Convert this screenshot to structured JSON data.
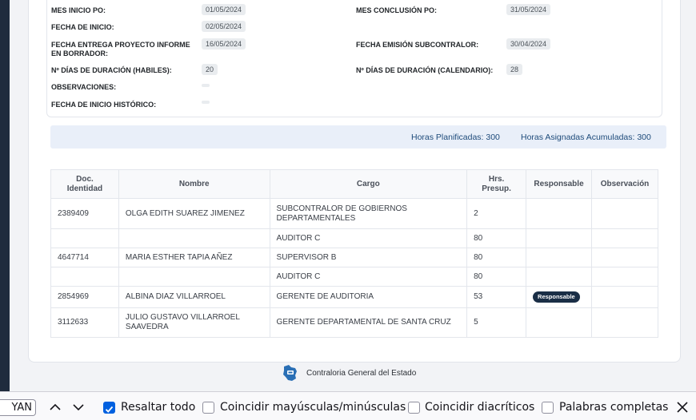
{
  "details": {
    "mes_inicio_label": "MES INICIO PO:",
    "mes_inicio_value": "01/05/2024",
    "mes_conclusion_label": "MES CONCLUSIÓN PO:",
    "mes_conclusion_value": "31/05/2024",
    "fecha_inicio_label": "FECHA DE INICIO:",
    "fecha_inicio_value": "02/05/2024",
    "fecha_entrega_label_1": "FECHA ENTREGA PROYECTO INFORME",
    "fecha_entrega_label_2": "EN BORRADOR:",
    "fecha_entrega_value": "16/05/2024",
    "fecha_emision_label": "FECHA EMISIÓN SUBCONTRALOR:",
    "fecha_emision_value": "30/04/2024",
    "dias_habiles_label": "Nº DÍAS DE DURACIÓN (HABILES):",
    "dias_habiles_value": "20",
    "dias_calendario_label": "Nº DÍAS DE DURACIÓN (CALENDARIO):",
    "dias_calendario_value": "28",
    "observaciones_label": "OBSERVACIONES:",
    "observaciones_value": "",
    "fecha_historico_label": "FECHA DE INICIO HISTÓRICO:",
    "fecha_historico_value": ""
  },
  "hours": {
    "planificadas": "Horas Planificadas: 300",
    "asignadas": "Horas Asignadas Acumuladas: 300"
  },
  "table": {
    "headers": {
      "doc_1": "Doc.",
      "doc_2": "Identidad",
      "nombre": "Nombre",
      "cargo": "Cargo",
      "hrs_1": "Hrs.",
      "hrs_2": "Presup.",
      "responsable": "Responsable",
      "observacion": "Observación"
    },
    "rows": [
      {
        "doc": "2389409",
        "nombre": "OLGA EDITH SUAREZ JIMENEZ",
        "cargo": "SUBCONTRALOR DE GOBIERNOS DEPARTAMENTALES",
        "hrs": "2",
        "responsable": "",
        "observacion": ""
      },
      {
        "doc": "",
        "nombre": "",
        "cargo": "AUDITOR C",
        "hrs": "80",
        "responsable": "",
        "observacion": ""
      },
      {
        "doc": "4647714",
        "nombre": "MARIA ESTHER TAPIA AÑEZ",
        "cargo": "SUPERVISOR B",
        "hrs": "80",
        "responsable": "",
        "observacion": ""
      },
      {
        "doc": "",
        "nombre": "",
        "cargo": "AUDITOR C",
        "hrs": "80",
        "responsable": "",
        "observacion": ""
      },
      {
        "doc": "2854969",
        "nombre": "ALBINA DIAZ VILLARROEL",
        "cargo": "GERENTE DE AUDITORIA",
        "hrs": "53",
        "responsable": "Responsable",
        "observacion": ""
      },
      {
        "doc": "3112633",
        "nombre": "JULIO GUSTAVO VILLARROEL SAAVEDRA",
        "cargo": "GERENTE DEPARTAMENTAL DE SANTA CRUZ",
        "hrs": "5",
        "responsable": "",
        "observacion": ""
      }
    ]
  },
  "footer": {
    "org_name": "Contraloria General del Estado",
    "logo_icon": "bolivia-map-logo-icon"
  },
  "findbar": {
    "search_value": "YAN",
    "highlight_all": "Resaltar todo",
    "match_case": "Coincidir mayúsculas/minúsculas",
    "match_diacritics": "Coincidir diacríticos",
    "whole_words": "Palabras completas",
    "highlight_all_checked": true,
    "match_case_checked": false,
    "match_diacritics_checked": false,
    "whole_words_checked": false,
    "accent_color": "#0061e0"
  }
}
